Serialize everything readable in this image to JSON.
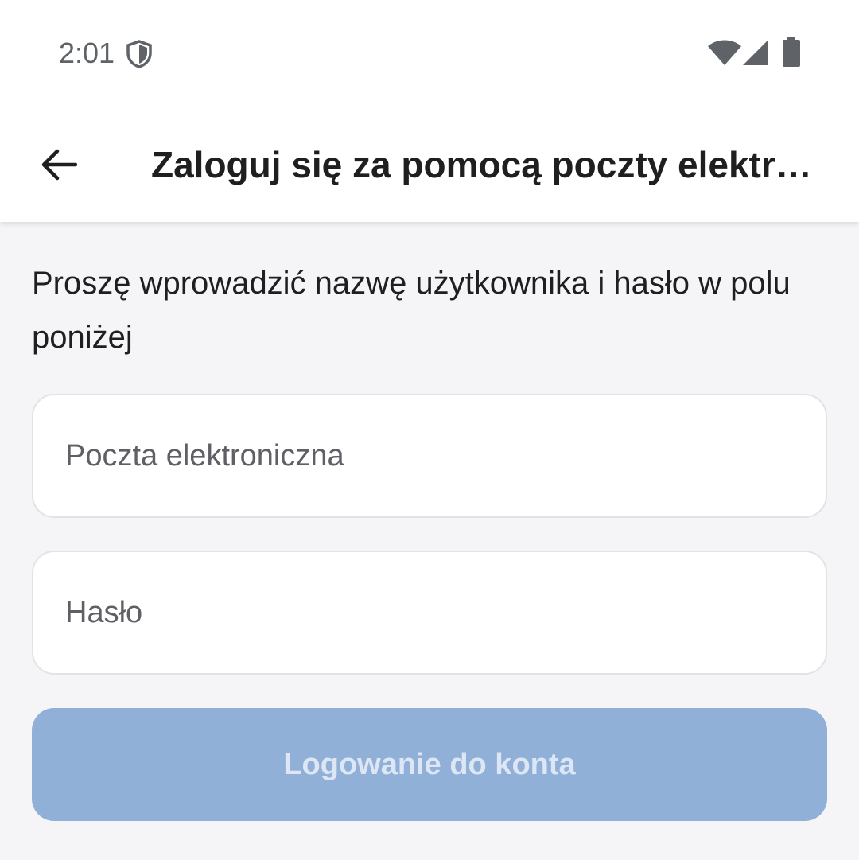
{
  "status_bar": {
    "time": "2:01",
    "icons": [
      "shield-icon",
      "wifi-icon",
      "signal-icon",
      "battery-icon"
    ]
  },
  "app_bar": {
    "back_icon": "arrow-left-icon",
    "title": "Zaloguj się za pomocą poczty elektro..."
  },
  "main": {
    "instructions": "Proszę wprowadzić nazwę użytkownika i hasło w polu poniżej",
    "email": {
      "value": "",
      "placeholder": "Poczta elektroniczna"
    },
    "password": {
      "value": "",
      "placeholder": "Hasło"
    },
    "login_label": "Logowanie do konta"
  },
  "colors": {
    "background": "#f5f5f8",
    "surface": "#ffffff",
    "button_disabled": "#91b0d8",
    "button_text_disabled": "#dce6f4",
    "text_primary": "#1f1f1f"
  }
}
